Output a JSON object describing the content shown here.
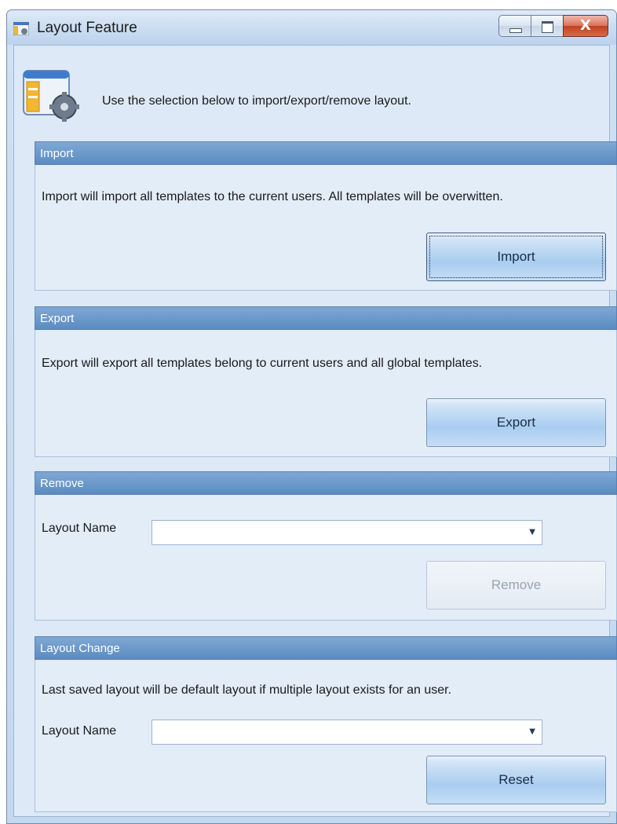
{
  "window": {
    "title": "Layout Feature",
    "controls": {
      "minimize": "minimize",
      "maximize": "maximize",
      "close": "X"
    }
  },
  "header": {
    "icon": "layout-settings-icon",
    "text": "Use the selection below to import/export/remove layout."
  },
  "import": {
    "title": "Import",
    "description": "Import will import all templates to the current users. All templates will be overwitten.",
    "button": "Import"
  },
  "export": {
    "title": "Export",
    "description": "Export will export all templates belong to current users and all global templates.",
    "button": "Export"
  },
  "remove": {
    "title": "Remove",
    "layout_label": "Layout Name",
    "layout_value": "",
    "button": "Remove"
  },
  "layout_change": {
    "title": "Layout Change",
    "description": "Last saved layout will be default layout if multiple layout exists for an user.",
    "layout_label": "Layout Name",
    "layout_value": "",
    "button": "Reset"
  },
  "colors": {
    "group_header": "#5b8bc1",
    "client_bg": "#dde9f6",
    "close_button": "#c0411f"
  }
}
